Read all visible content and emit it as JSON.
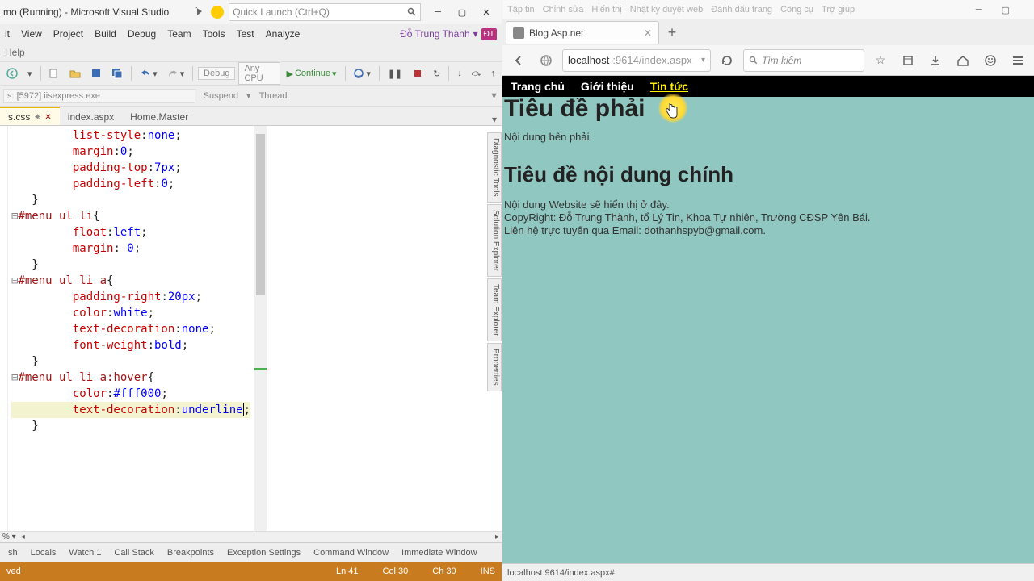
{
  "vs": {
    "title": "mo (Running) - Microsoft Visual Studio",
    "quick_launch_placeholder": "Quick Launch (Ctrl+Q)",
    "menu": [
      "it",
      "View",
      "Project",
      "Build",
      "Debug",
      "Team",
      "Tools",
      "Test",
      "Analyze"
    ],
    "menu2": [
      "Help"
    ],
    "user": "Đỗ Trung Thành",
    "user_badge": "ĐT",
    "toolbar": {
      "debug": "Debug",
      "anycpu": "Any CPU",
      "continue": "Continue"
    },
    "toolbar2": {
      "process": "s: [5972] iisexpress.exe",
      "suspend": "Suspend",
      "thread": "Thread:"
    },
    "tabs": [
      {
        "name": "s.css",
        "active": true,
        "dirty": true
      },
      {
        "name": "index.aspx",
        "active": false
      },
      {
        "name": "Home.Master",
        "active": false
      }
    ],
    "code_lines": [
      {
        "indent": 3,
        "prop": "list-style",
        "val": "none"
      },
      {
        "indent": 3,
        "prop": "margin",
        "val": "0"
      },
      {
        "indent": 3,
        "prop": "padding-top",
        "val": "7px"
      },
      {
        "indent": 3,
        "prop": "padding-left",
        "val": "0"
      },
      {
        "indent": 1,
        "close": true
      },
      {
        "indent": 0,
        "sel": "#menu ul li",
        "open": true
      },
      {
        "indent": 3,
        "prop": "float",
        "val": "left"
      },
      {
        "indent": 3,
        "prop": "margin",
        "val": " 0"
      },
      {
        "indent": 1,
        "close": true
      },
      {
        "indent": 0,
        "sel": "#menu ul li a",
        "open": true
      },
      {
        "indent": 3,
        "prop": "padding-right",
        "val": "20px"
      },
      {
        "indent": 3,
        "prop": "color",
        "val": "white"
      },
      {
        "indent": 3,
        "prop": "text-decoration",
        "val": "none"
      },
      {
        "indent": 3,
        "prop": "font-weight",
        "val": "bold"
      },
      {
        "indent": 1,
        "close": true
      },
      {
        "indent": 0,
        "sel": "#menu ul li a:hover",
        "open": true
      },
      {
        "indent": 3,
        "prop": "color",
        "val": "#fff000"
      },
      {
        "indent": 3,
        "prop": "text-decoration",
        "val": "underline",
        "cursor": true,
        "highlight": true
      },
      {
        "indent": 1,
        "close": true
      }
    ],
    "side_tools": [
      "Diagnostic Tools",
      "Solution Explorer",
      "Team Explorer",
      "Properties"
    ],
    "bottom_start": "% ▾",
    "panels": [
      "sh",
      "Locals",
      "Watch 1",
      "Call Stack",
      "Breakpoints",
      "Exception Settings",
      "Command Window",
      "Immediate Window"
    ],
    "status": {
      "left": "ved",
      "ln": "Ln 41",
      "col": "Col 30",
      "ch": "Ch 30",
      "ins": "INS"
    }
  },
  "ff": {
    "menubar": [
      "Tập tin",
      "Chỉnh sửa",
      "Hiển thị",
      "Nhật ký duyệt web",
      "Đánh dấu trang",
      "Công cụ",
      "Trợ giúp"
    ],
    "tab_title": "Blog Asp.net",
    "url_host": "localhost",
    "url_path": ":9614/index.aspx",
    "search_placeholder": "Tìm kiếm",
    "page": {
      "nav": [
        "Trang chủ",
        "Giới thiệu",
        "Tin tức"
      ],
      "h1a": "Tiêu đề phải",
      "p1": "Nội dung bên phải.",
      "h1b": "Tiêu đề nội dung chính",
      "body1": "Nội dung Website sẽ hiển thị ở đây.",
      "body2": "CopyRight: Đỗ Trung Thành, tổ Lý Tin, Khoa Tự nhiên, Trường CĐSP Yên Bái.",
      "body3": "Liên hệ trực tuyến qua Email: dothanhspyb@gmail.com."
    },
    "status": "localhost:9614/index.aspx#"
  }
}
